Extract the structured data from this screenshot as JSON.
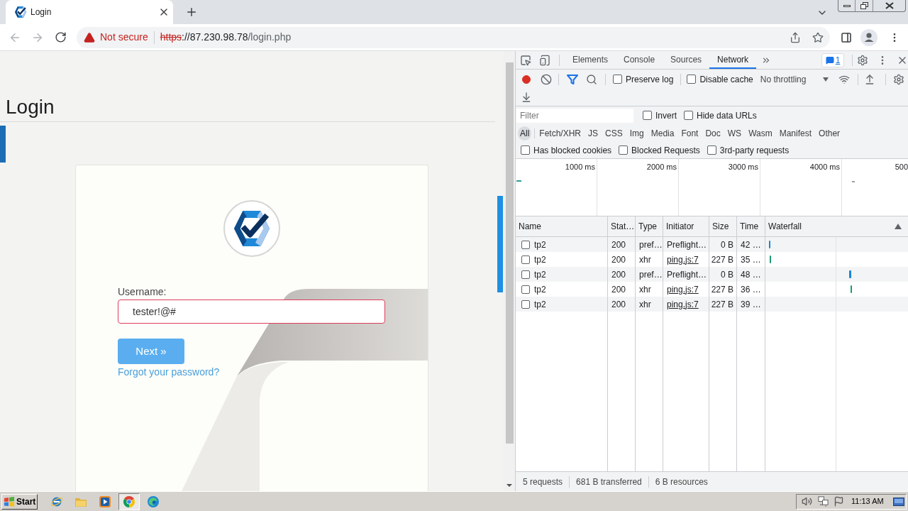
{
  "browser": {
    "tab": {
      "title": "Login"
    },
    "address": {
      "security": "Not secure",
      "scheme": "https",
      "host": "://87.230.98.78",
      "path": "/login.php"
    }
  },
  "page": {
    "heading": "Login",
    "form": {
      "label": "Username:",
      "value": "tester!@#",
      "invalid": true,
      "submit": "Next »",
      "link": "Forgot your password?"
    }
  },
  "devtools": {
    "tabs": [
      {
        "label": "Elements",
        "selected": false
      },
      {
        "label": "Console",
        "selected": false
      },
      {
        "label": "Sources",
        "selected": false
      },
      {
        "label": "Network",
        "selected": true
      }
    ],
    "issues_badge": "1",
    "toolbar": {
      "recording": true,
      "options": [
        {
          "label": "Preserve log",
          "checked": false
        },
        {
          "label": "Disable cache",
          "checked": false
        }
      ],
      "throttling": "No throttling"
    },
    "filter": {
      "placeholder": "Filter",
      "options": [
        {
          "label": "Invert",
          "checked": false
        },
        {
          "label": "Hide data URLs",
          "checked": false
        }
      ]
    },
    "types": [
      {
        "label": "All",
        "selected": true
      },
      {
        "label": "Fetch/XHR",
        "selected": false
      },
      {
        "label": "JS",
        "selected": false
      },
      {
        "label": "CSS",
        "selected": false
      },
      {
        "label": "Img",
        "selected": false
      },
      {
        "label": "Media",
        "selected": false
      },
      {
        "label": "Font",
        "selected": false
      },
      {
        "label": "Doc",
        "selected": false
      },
      {
        "label": "WS",
        "selected": false
      },
      {
        "label": "Wasm",
        "selected": false
      },
      {
        "label": "Manifest",
        "selected": false
      },
      {
        "label": "Other",
        "selected": false
      }
    ],
    "blocked_options": [
      {
        "label": "Has blocked cookies",
        "checked": false
      },
      {
        "label": "Blocked Requests",
        "checked": false
      },
      {
        "label": "3rd-party requests",
        "checked": false
      }
    ],
    "overview": {
      "ticks": [
        "1000 ms",
        "2000 ms",
        "3000 ms",
        "4000 ms",
        "500"
      ]
    },
    "table": {
      "columns": [
        "Name",
        "Stat…",
        "Type",
        "Initiator",
        "Size",
        "Time",
        "Waterfall"
      ],
      "rows": [
        {
          "name": "tp2",
          "status": "200",
          "type": "pref…",
          "initiator": "Preflight…",
          "initiator_link": false,
          "size": "0 B",
          "time": "42 …"
        },
        {
          "name": "tp2",
          "status": "200",
          "type": "xhr",
          "initiator": "ping.js:7",
          "initiator_link": true,
          "size": "227 B",
          "time": "35 …"
        },
        {
          "name": "tp2",
          "status": "200",
          "type": "pref…",
          "initiator": "Preflight…",
          "initiator_link": false,
          "size": "0 B",
          "time": "48 …"
        },
        {
          "name": "tp2",
          "status": "200",
          "type": "xhr",
          "initiator": "ping.js:7",
          "initiator_link": true,
          "size": "227 B",
          "time": "36 …"
        },
        {
          "name": "tp2",
          "status": "200",
          "type": "xhr",
          "initiator": "ping.js:7",
          "initiator_link": true,
          "size": "227 B",
          "time": "39 …"
        }
      ]
    },
    "status_bar": [
      "5 requests",
      "681 B transferred",
      "6 B resources"
    ]
  },
  "taskbar": {
    "start": "Start",
    "apps": [
      {
        "kind": "ie",
        "selected": false
      },
      {
        "kind": "explorer",
        "selected": false
      },
      {
        "kind": "media",
        "selected": false
      },
      {
        "kind": "chrome",
        "selected": true
      },
      {
        "kind": "edge",
        "selected": false
      }
    ],
    "clock": "11:13 AM"
  }
}
